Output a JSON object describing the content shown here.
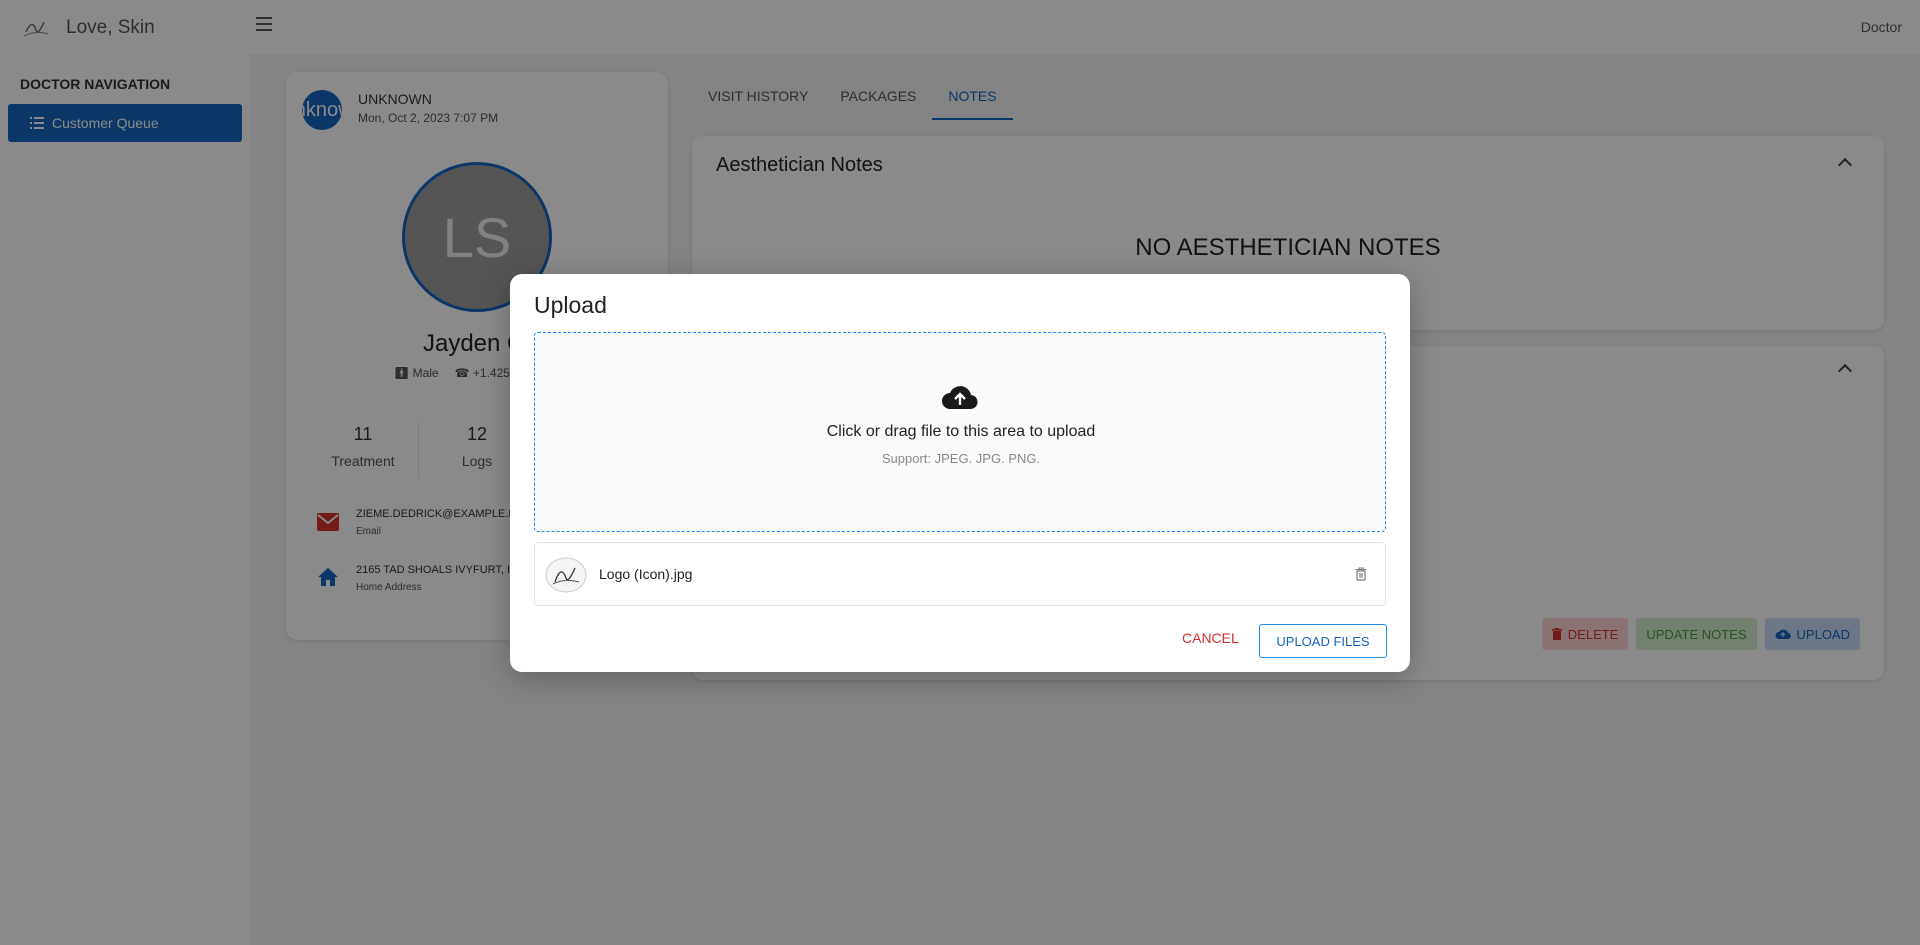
{
  "app": {
    "title": "Love, Skin",
    "user_role": "Doctor"
  },
  "sidebar": {
    "heading": "DOCTOR NAVIGATION",
    "items": [
      {
        "label": "Customer Queue",
        "icon": "list-icon",
        "active": true
      }
    ]
  },
  "patient": {
    "status": "UNKNOWN",
    "date": "Mon, Oct 2, 2023 7:07 PM",
    "small_avatar_text": "Unknown",
    "initials": "LS",
    "name": "Jayden C.",
    "gender": "Male",
    "phone": "+1.425.",
    "stats": [
      {
        "value": "11",
        "label": "Treatment"
      },
      {
        "value": "12",
        "label": "Logs"
      }
    ],
    "email": "ZIEME.DEDRICK@EXAMPLE.N",
    "email_label": "Email",
    "address": "2165 TAD SHOALS IVYFURT, I",
    "address_label": "Home Address"
  },
  "tabs": [
    {
      "label": "VISIT HISTORY",
      "active": false
    },
    {
      "label": "PACKAGES",
      "active": false
    },
    {
      "label": "NOTES",
      "active": true
    }
  ],
  "notes": {
    "title": "Aesthetician Notes",
    "empty_text": "NO AESTHETICIAN NOTES"
  },
  "actions": {
    "delete": "DELETE",
    "update": "UPDATE NOTES",
    "upload": "UPLOAD"
  },
  "modal": {
    "title": "Upload",
    "drop_text": "Click or drag file to this area to upload",
    "support_text": "Support: JPEG. JPG. PNG.",
    "file_name": "Logo (Icon).jpg",
    "cancel": "CANCEL",
    "upload": "UPLOAD FILES"
  },
  "colors": {
    "primary": "#1565c0",
    "danger": "#d32f2f",
    "success": "#4a9a3a"
  }
}
